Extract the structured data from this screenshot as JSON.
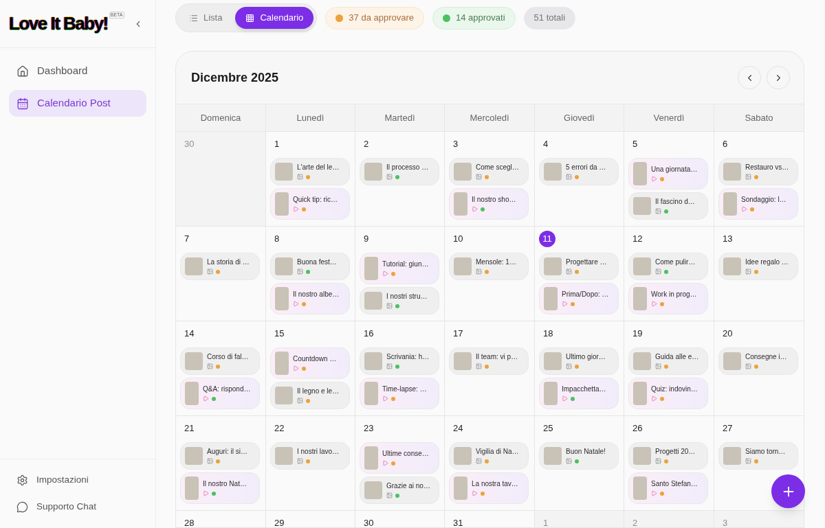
{
  "sidebar": {
    "logo": "Love It Baby!",
    "logo_badge": "BETA",
    "items": [
      {
        "label": "Dashboard",
        "kind": "home",
        "selected": false
      },
      {
        "label": "Calendario Post",
        "kind": "calendar",
        "selected": true
      }
    ],
    "footer_items": [
      {
        "label": "Impostazioni",
        "kind": "settings"
      },
      {
        "label": "Supporto Chat",
        "kind": "chat"
      }
    ]
  },
  "view_tabs": [
    {
      "label": "Lista",
      "kind": "list",
      "selected": false
    },
    {
      "label": "Calendario",
      "kind": "calendar",
      "selected": true
    }
  ],
  "stats": [
    {
      "label": "37 da approvare",
      "kind": "pending"
    },
    {
      "label": "14 approvati",
      "kind": "approved"
    },
    {
      "label": "51 totali",
      "kind": "total"
    }
  ],
  "calendar": {
    "title": "Dicembre 2025",
    "weekdays": [
      "Domenica",
      "Lunedì",
      "Martedì",
      "Mercoledì",
      "Giovedì",
      "Venerdì",
      "Sabato"
    ],
    "weeks": [
      [
        {
          "day": "30",
          "other_month": true,
          "today": false
        },
        {
          "day": "1",
          "other_month": false,
          "today": false,
          "posts": [
            {
              "title": "L'arte del le…",
              "kind": "image",
              "approved": false
            },
            {
              "title": "Quick tip: ric…",
              "kind": "video",
              "approved": false
            }
          ]
        },
        {
          "day": "2",
          "other_month": false,
          "today": false,
          "posts": [
            {
              "title": "Il processo …",
              "kind": "image",
              "approved": true
            }
          ]
        },
        {
          "day": "3",
          "other_month": false,
          "today": false,
          "posts": [
            {
              "title": "Come scegl…",
              "kind": "image",
              "approved": false
            },
            {
              "title": "Il nostro sho…",
              "kind": "video",
              "approved": true
            }
          ]
        },
        {
          "day": "4",
          "other_month": false,
          "today": false,
          "posts": [
            {
              "title": "5 errori da …",
              "kind": "image",
              "approved": false
            }
          ]
        },
        {
          "day": "5",
          "other_month": false,
          "today": false,
          "posts": [
            {
              "title": "Una giornata…",
              "kind": "video",
              "approved": false
            },
            {
              "title": "Il fascino d…",
              "kind": "image",
              "approved": true
            }
          ]
        },
        {
          "day": "6",
          "other_month": false,
          "today": false,
          "posts": [
            {
              "title": "Restauro vs…",
              "kind": "image",
              "approved": false
            },
            {
              "title": "Sondaggio: l…",
              "kind": "video",
              "approved": false
            }
          ]
        }
      ],
      [
        {
          "day": "7",
          "other_month": false,
          "today": false,
          "posts": [
            {
              "title": "La storia di …",
              "kind": "image",
              "approved": false
            }
          ]
        },
        {
          "day": "8",
          "other_month": false,
          "today": false,
          "posts": [
            {
              "title": "Buona fest…",
              "kind": "image",
              "approved": true
            },
            {
              "title": "Il nostro albe…",
              "kind": "video",
              "approved": false
            }
          ]
        },
        {
          "day": "9",
          "other_month": false,
          "today": false,
          "posts": [
            {
              "title": "Tutorial: giun…",
              "kind": "video",
              "approved": false
            },
            {
              "title": "I nostri stru…",
              "kind": "image",
              "approved": true
            }
          ]
        },
        {
          "day": "10",
          "other_month": false,
          "today": false,
          "posts": [
            {
              "title": "Mensole: 1…",
              "kind": "image",
              "approved": false
            }
          ]
        },
        {
          "day": "11",
          "other_month": false,
          "today": true,
          "posts": [
            {
              "title": "Progettare …",
              "kind": "image",
              "approved": false
            },
            {
              "title": "Prima/Dopo: …",
              "kind": "video",
              "approved": false
            }
          ]
        },
        {
          "day": "12",
          "other_month": false,
          "today": false,
          "posts": [
            {
              "title": "Come pulir…",
              "kind": "image",
              "approved": true
            },
            {
              "title": "Work in prog…",
              "kind": "video",
              "approved": false
            }
          ]
        },
        {
          "day": "13",
          "other_month": false,
          "today": false,
          "posts": [
            {
              "title": "Idee regalo …",
              "kind": "image",
              "approved": false
            }
          ]
        }
      ],
      [
        {
          "day": "14",
          "other_month": false,
          "today": false,
          "posts": [
            {
              "title": "Corso di fal…",
              "kind": "image",
              "approved": false
            },
            {
              "title": "Q&A: rispond…",
              "kind": "video",
              "approved": true
            }
          ]
        },
        {
          "day": "15",
          "other_month": false,
          "today": false,
          "posts": [
            {
              "title": "Countdown …",
              "kind": "video",
              "approved": false
            },
            {
              "title": "Il legno e le…",
              "kind": "image",
              "approved": false
            }
          ]
        },
        {
          "day": "16",
          "other_month": false,
          "today": false,
          "posts": [
            {
              "title": "Scrivania: h…",
              "kind": "image",
              "approved": true
            },
            {
              "title": "Time-lapse: …",
              "kind": "video",
              "approved": false
            }
          ]
        },
        {
          "day": "17",
          "other_month": false,
          "today": false,
          "posts": [
            {
              "title": "Il team: vi p…",
              "kind": "image",
              "approved": false
            }
          ]
        },
        {
          "day": "18",
          "other_month": false,
          "today": false,
          "posts": [
            {
              "title": "Ultimo gior…",
              "kind": "image",
              "approved": false
            },
            {
              "title": "Impacchetta…",
              "kind": "video",
              "approved": true
            }
          ]
        },
        {
          "day": "19",
          "other_month": false,
          "today": false,
          "posts": [
            {
              "title": "Guida alle e…",
              "kind": "image",
              "approved": false
            },
            {
              "title": "Quiz: indovin…",
              "kind": "video",
              "approved": false
            }
          ]
        },
        {
          "day": "20",
          "other_month": false,
          "today": false,
          "posts": [
            {
              "title": "Consegne i…",
              "kind": "image",
              "approved": false
            }
          ]
        }
      ],
      [
        {
          "day": "21",
          "other_month": false,
          "today": false,
          "posts": [
            {
              "title": "Auguri: il si…",
              "kind": "image",
              "approved": false
            },
            {
              "title": "Il nostro Nat…",
              "kind": "video",
              "approved": true
            }
          ]
        },
        {
          "day": "22",
          "other_month": false,
          "today": false,
          "posts": [
            {
              "title": "I nostri lavo…",
              "kind": "image",
              "approved": false
            }
          ]
        },
        {
          "day": "23",
          "other_month": false,
          "today": false,
          "posts": [
            {
              "title": "Ultime conse…",
              "kind": "video",
              "approved": false
            },
            {
              "title": "Grazie ai no…",
              "kind": "image",
              "approved": true
            }
          ]
        },
        {
          "day": "24",
          "other_month": false,
          "today": false,
          "posts": [
            {
              "title": "Vigilia di Na…",
              "kind": "image",
              "approved": false
            },
            {
              "title": "La nostra tav…",
              "kind": "video",
              "approved": false
            }
          ]
        },
        {
          "day": "25",
          "other_month": false,
          "today": false,
          "posts": [
            {
              "title": "Buon Natale!",
              "kind": "image",
              "approved": true
            }
          ]
        },
        {
          "day": "26",
          "other_month": false,
          "today": false,
          "posts": [
            {
              "title": "Progetti 20…",
              "kind": "image",
              "approved": false
            },
            {
              "title": "Santo Stefan…",
              "kind": "video",
              "approved": false
            }
          ]
        },
        {
          "day": "27",
          "other_month": false,
          "today": false,
          "posts": [
            {
              "title": "Siamo torn…",
              "kind": "image",
              "approved": false
            }
          ]
        }
      ],
      [
        {
          "day": "28",
          "other_month": false,
          "today": false
        },
        {
          "day": "29",
          "other_month": false,
          "today": false
        },
        {
          "day": "30",
          "other_month": false,
          "today": false
        },
        {
          "day": "31",
          "other_month": false,
          "today": false
        },
        {
          "day": "1",
          "other_month": true,
          "today": false
        },
        {
          "day": "2",
          "other_month": true,
          "today": false
        },
        {
          "day": "3",
          "other_month": true,
          "today": false
        }
      ]
    ]
  }
}
